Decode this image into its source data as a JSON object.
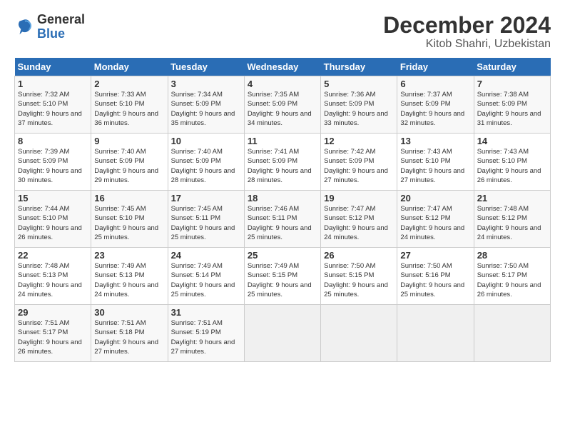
{
  "header": {
    "logo_general": "General",
    "logo_blue": "Blue",
    "title": "December 2024",
    "subtitle": "Kitob Shahri, Uzbekistan"
  },
  "calendar": {
    "days_of_week": [
      "Sunday",
      "Monday",
      "Tuesday",
      "Wednesday",
      "Thursday",
      "Friday",
      "Saturday"
    ],
    "weeks": [
      [
        null,
        {
          "day": "2",
          "sunrise": "7:33 AM",
          "sunset": "5:10 PM",
          "daylight": "9 hours and 36 minutes."
        },
        {
          "day": "3",
          "sunrise": "7:34 AM",
          "sunset": "5:09 PM",
          "daylight": "9 hours and 35 minutes."
        },
        {
          "day": "4",
          "sunrise": "7:35 AM",
          "sunset": "5:09 PM",
          "daylight": "9 hours and 34 minutes."
        },
        {
          "day": "5",
          "sunrise": "7:36 AM",
          "sunset": "5:09 PM",
          "daylight": "9 hours and 33 minutes."
        },
        {
          "day": "6",
          "sunrise": "7:37 AM",
          "sunset": "5:09 PM",
          "daylight": "9 hours and 32 minutes."
        },
        {
          "day": "7",
          "sunrise": "7:38 AM",
          "sunset": "5:09 PM",
          "daylight": "9 hours and 31 minutes."
        }
      ],
      [
        {
          "day": "1",
          "sunrise": "7:32 AM",
          "sunset": "5:10 PM",
          "daylight": "9 hours and 37 minutes."
        },
        null,
        null,
        null,
        null,
        null,
        null
      ],
      [
        {
          "day": "8",
          "sunrise": "7:39 AM",
          "sunset": "5:09 PM",
          "daylight": "9 hours and 30 minutes."
        },
        {
          "day": "9",
          "sunrise": "7:40 AM",
          "sunset": "5:09 PM",
          "daylight": "9 hours and 29 minutes."
        },
        {
          "day": "10",
          "sunrise": "7:40 AM",
          "sunset": "5:09 PM",
          "daylight": "9 hours and 28 minutes."
        },
        {
          "day": "11",
          "sunrise": "7:41 AM",
          "sunset": "5:09 PM",
          "daylight": "9 hours and 28 minutes."
        },
        {
          "day": "12",
          "sunrise": "7:42 AM",
          "sunset": "5:09 PM",
          "daylight": "9 hours and 27 minutes."
        },
        {
          "day": "13",
          "sunrise": "7:43 AM",
          "sunset": "5:10 PM",
          "daylight": "9 hours and 27 minutes."
        },
        {
          "day": "14",
          "sunrise": "7:43 AM",
          "sunset": "5:10 PM",
          "daylight": "9 hours and 26 minutes."
        }
      ],
      [
        {
          "day": "15",
          "sunrise": "7:44 AM",
          "sunset": "5:10 PM",
          "daylight": "9 hours and 26 minutes."
        },
        {
          "day": "16",
          "sunrise": "7:45 AM",
          "sunset": "5:10 PM",
          "daylight": "9 hours and 25 minutes."
        },
        {
          "day": "17",
          "sunrise": "7:45 AM",
          "sunset": "5:11 PM",
          "daylight": "9 hours and 25 minutes."
        },
        {
          "day": "18",
          "sunrise": "7:46 AM",
          "sunset": "5:11 PM",
          "daylight": "9 hours and 25 minutes."
        },
        {
          "day": "19",
          "sunrise": "7:47 AM",
          "sunset": "5:12 PM",
          "daylight": "9 hours and 24 minutes."
        },
        {
          "day": "20",
          "sunrise": "7:47 AM",
          "sunset": "5:12 PM",
          "daylight": "9 hours and 24 minutes."
        },
        {
          "day": "21",
          "sunrise": "7:48 AM",
          "sunset": "5:12 PM",
          "daylight": "9 hours and 24 minutes."
        }
      ],
      [
        {
          "day": "22",
          "sunrise": "7:48 AM",
          "sunset": "5:13 PM",
          "daylight": "9 hours and 24 minutes."
        },
        {
          "day": "23",
          "sunrise": "7:49 AM",
          "sunset": "5:13 PM",
          "daylight": "9 hours and 24 minutes."
        },
        {
          "day": "24",
          "sunrise": "7:49 AM",
          "sunset": "5:14 PM",
          "daylight": "9 hours and 25 minutes."
        },
        {
          "day": "25",
          "sunrise": "7:49 AM",
          "sunset": "5:15 PM",
          "daylight": "9 hours and 25 minutes."
        },
        {
          "day": "26",
          "sunrise": "7:50 AM",
          "sunset": "5:15 PM",
          "daylight": "9 hours and 25 minutes."
        },
        {
          "day": "27",
          "sunrise": "7:50 AM",
          "sunset": "5:16 PM",
          "daylight": "9 hours and 25 minutes."
        },
        {
          "day": "28",
          "sunrise": "7:50 AM",
          "sunset": "5:17 PM",
          "daylight": "9 hours and 26 minutes."
        }
      ],
      [
        {
          "day": "29",
          "sunrise": "7:51 AM",
          "sunset": "5:17 PM",
          "daylight": "9 hours and 26 minutes."
        },
        {
          "day": "30",
          "sunrise": "7:51 AM",
          "sunset": "5:18 PM",
          "daylight": "9 hours and 27 minutes."
        },
        {
          "day": "31",
          "sunrise": "7:51 AM",
          "sunset": "5:19 PM",
          "daylight": "9 hours and 27 minutes."
        },
        null,
        null,
        null,
        null
      ]
    ]
  }
}
